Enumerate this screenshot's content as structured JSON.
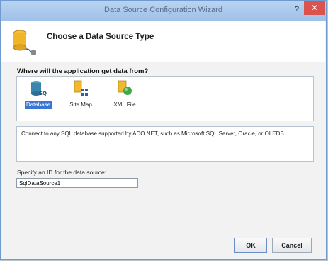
{
  "window": {
    "title": "Data Source Configuration Wizard",
    "help_glyph": "?",
    "close_glyph": "✕"
  },
  "header": {
    "title": "Choose a Data Source Type"
  },
  "types": {
    "question": "Where will the application get data from?",
    "items": [
      {
        "label": "Database",
        "icon": "database-icon",
        "selected": true
      },
      {
        "label": "Site Map",
        "icon": "site-map-icon",
        "selected": false
      },
      {
        "label": "XML File",
        "icon": "xml-file-icon",
        "selected": false
      }
    ]
  },
  "description": "Connect to any SQL database supported by ADO.NET, such as Microsoft SQL Server, Oracle, or OLEDB.",
  "data_source_id": {
    "label": "Specify an ID for the data source:",
    "value": "SqlDataSource1"
  },
  "buttons": {
    "ok": "OK",
    "cancel": "Cancel"
  },
  "colors": {
    "titlebar": "#a9c8ee",
    "selection": "#3a76d6",
    "close": "#d9534f"
  }
}
